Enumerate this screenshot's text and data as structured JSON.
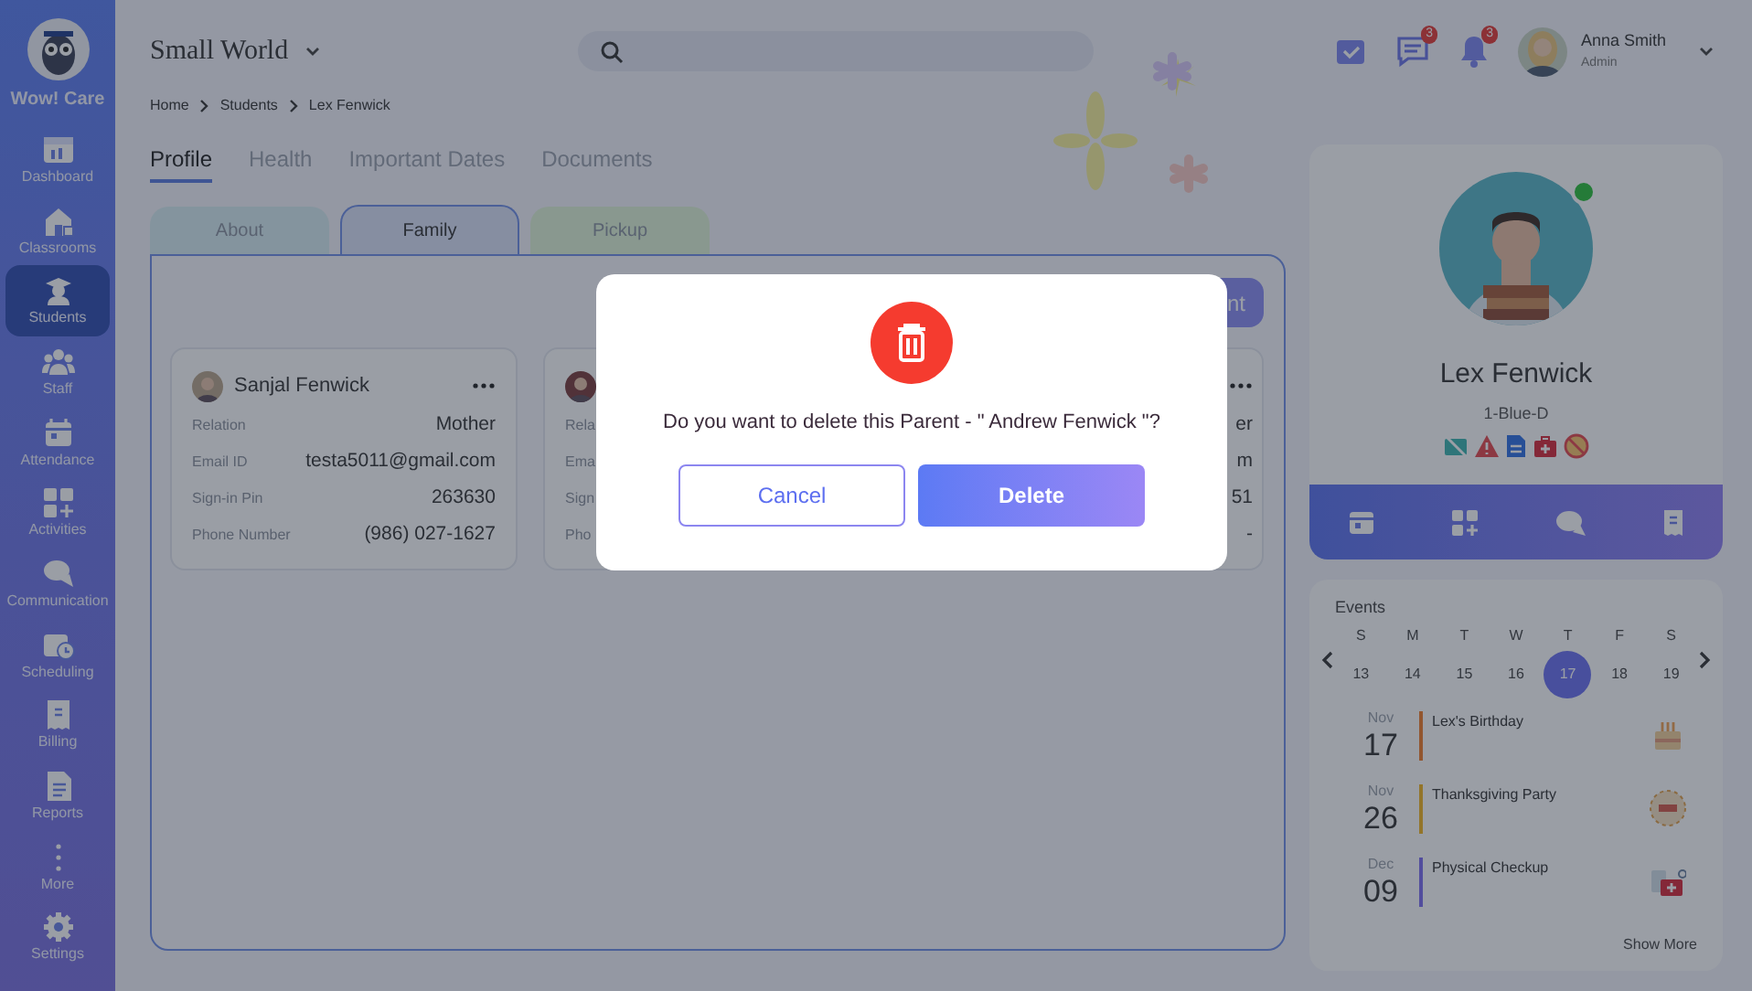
{
  "app": {
    "name": "Wow! Care"
  },
  "sidebar": {
    "items": [
      {
        "label": "Dashboard",
        "selected": false
      },
      {
        "label": "Classrooms",
        "selected": false
      },
      {
        "label": "Students",
        "selected": true
      },
      {
        "label": "Staff",
        "selected": false
      },
      {
        "label": "Attendance",
        "selected": false
      },
      {
        "label": "Activities",
        "selected": false
      },
      {
        "label": "Communication",
        "selected": false
      },
      {
        "label": "Scheduling",
        "selected": false
      },
      {
        "label": "Billing",
        "selected": false
      },
      {
        "label": "Reports",
        "selected": false
      },
      {
        "label": "More",
        "selected": false
      },
      {
        "label": "Settings",
        "selected": false
      }
    ]
  },
  "header": {
    "school": "Small World",
    "messages_badge": "3",
    "notifications_badge": "3",
    "user": {
      "name": "Anna Smith",
      "role": "Admin"
    }
  },
  "breadcrumb": [
    "Home",
    "Students",
    "Lex Fenwick"
  ],
  "tabs": [
    {
      "label": "Profile",
      "selected": true
    },
    {
      "label": "Health",
      "selected": false
    },
    {
      "label": "Important Dates",
      "selected": false
    },
    {
      "label": "Documents",
      "selected": false
    }
  ],
  "sub_tabs": [
    {
      "label": "About",
      "selected": false,
      "color": "#85959e"
    },
    {
      "label": "Family",
      "selected": true,
      "color": "#868fa1"
    },
    {
      "label": "Pickup",
      "selected": false,
      "color": "#89998f"
    }
  ],
  "action_button": {
    "label": "nt"
  },
  "parents": [
    {
      "name": "Sanjal Fenwick",
      "fields": [
        {
          "label": "Relation",
          "value": "Mother"
        },
        {
          "label": "Email ID",
          "value": "testa5011@gmail.com"
        },
        {
          "label": "Sign-in Pin",
          "value": "263630"
        },
        {
          "label": "Phone Number",
          "value": "(986) 027-1627"
        }
      ]
    },
    {
      "fields": [
        {
          "label": "Rela"
        },
        {
          "label": "Ema"
        },
        {
          "label": "Sign"
        },
        {
          "label": "Pho"
        }
      ]
    },
    {
      "fields": [
        {
          "value": "er"
        },
        {
          "value": "m"
        },
        {
          "value": "51"
        },
        {
          "value": "-"
        }
      ]
    }
  ],
  "student": {
    "name": "Lex Fenwick",
    "class": "1-Blue-D",
    "online": true
  },
  "events": {
    "title": "Events",
    "days": [
      {
        "weekday": "S",
        "date": "13",
        "selected": false
      },
      {
        "weekday": "M",
        "date": "14",
        "selected": false
      },
      {
        "weekday": "T",
        "date": "15",
        "selected": false
      },
      {
        "weekday": "W",
        "date": "16",
        "selected": false
      },
      {
        "weekday": "T",
        "date": "17",
        "selected": true
      },
      {
        "weekday": "F",
        "date": "18",
        "selected": false
      },
      {
        "weekday": "S",
        "date": "19",
        "selected": false
      }
    ],
    "items": [
      {
        "month": "Nov",
        "day": "17",
        "title": "Lex's Birthday",
        "color": "#92572f"
      },
      {
        "month": "Nov",
        "day": "26",
        "title": "Thanksgiving Party",
        "color": "#93762a"
      },
      {
        "month": "Dec",
        "day": "09",
        "title": "Physical Checkup",
        "color": "#524e9d"
      }
    ],
    "show_more": "Show More"
  },
  "dialog": {
    "message": "Do you want to delete this Parent - \" Andrew Fenwick \"?",
    "buttons": [
      {
        "label": "Cancel",
        "kind": "secondary"
      },
      {
        "label": "Delete",
        "kind": "primary"
      }
    ]
  }
}
